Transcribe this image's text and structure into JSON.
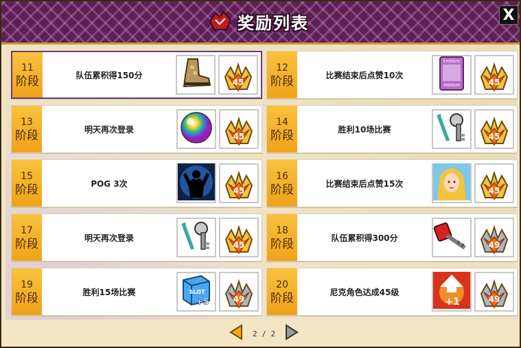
{
  "window": {
    "title": "奖励列表",
    "close_label": "X"
  },
  "rewards": [
    {
      "stage": "11",
      "stage_label": "阶段",
      "task": "队伍累积得150分",
      "item_icon": "boot-icon",
      "level": "45"
    },
    {
      "stage": "12",
      "stage_label": "阶段",
      "task": "比赛结束后点赞10次",
      "item_icon": "emblem-card-icon",
      "emblem_text": "Emblem",
      "emblem_sub": "PREMIUM",
      "level": "45"
    },
    {
      "stage": "13",
      "stage_label": "阶段",
      "task": "明天再次登录",
      "item_icon": "rainbow-orb-icon",
      "level": "45"
    },
    {
      "stage": "14",
      "stage_label": "阶段",
      "task": "胜利10场比赛",
      "item_icon": "key-strap-icon",
      "level": "45"
    },
    {
      "stage": "15",
      "stage_label": "阶段",
      "task": "POG 3次",
      "item_icon": "silhouette-buff-icon",
      "level": "45"
    },
    {
      "stage": "16",
      "stage_label": "阶段",
      "task": "比赛结束后点赞15次",
      "item_icon": "blonde-girl-portrait-icon",
      "level": "45"
    },
    {
      "stage": "17",
      "stage_label": "阶段",
      "task": "明天再次登录",
      "item_icon": "key-strap-icon",
      "level": "45"
    },
    {
      "stage": "18",
      "stage_label": "阶段",
      "task": "队伍累积得300分",
      "item_icon": "red-key-icon",
      "level": "49"
    },
    {
      "stage": "19",
      "stage_label": "阶段",
      "task": "胜利15场比赛",
      "item_icon": "slot-box-icon",
      "slot_text": "SLOT",
      "slot_plus": "+5",
      "level": "49"
    },
    {
      "stage": "20",
      "stage_label": "阶段",
      "task": "尼克角色达成45级",
      "item_icon": "level-up-arrow-icon",
      "levelup_text": "+1",
      "level": "49"
    }
  ],
  "pager": {
    "current": "2",
    "separator": "/",
    "total": "2"
  },
  "colors": {
    "header": "#5e1f55",
    "stage_gold": "#f0a21a",
    "lv45_badge": "#f5a000",
    "lv49_badge": "#e05020"
  }
}
